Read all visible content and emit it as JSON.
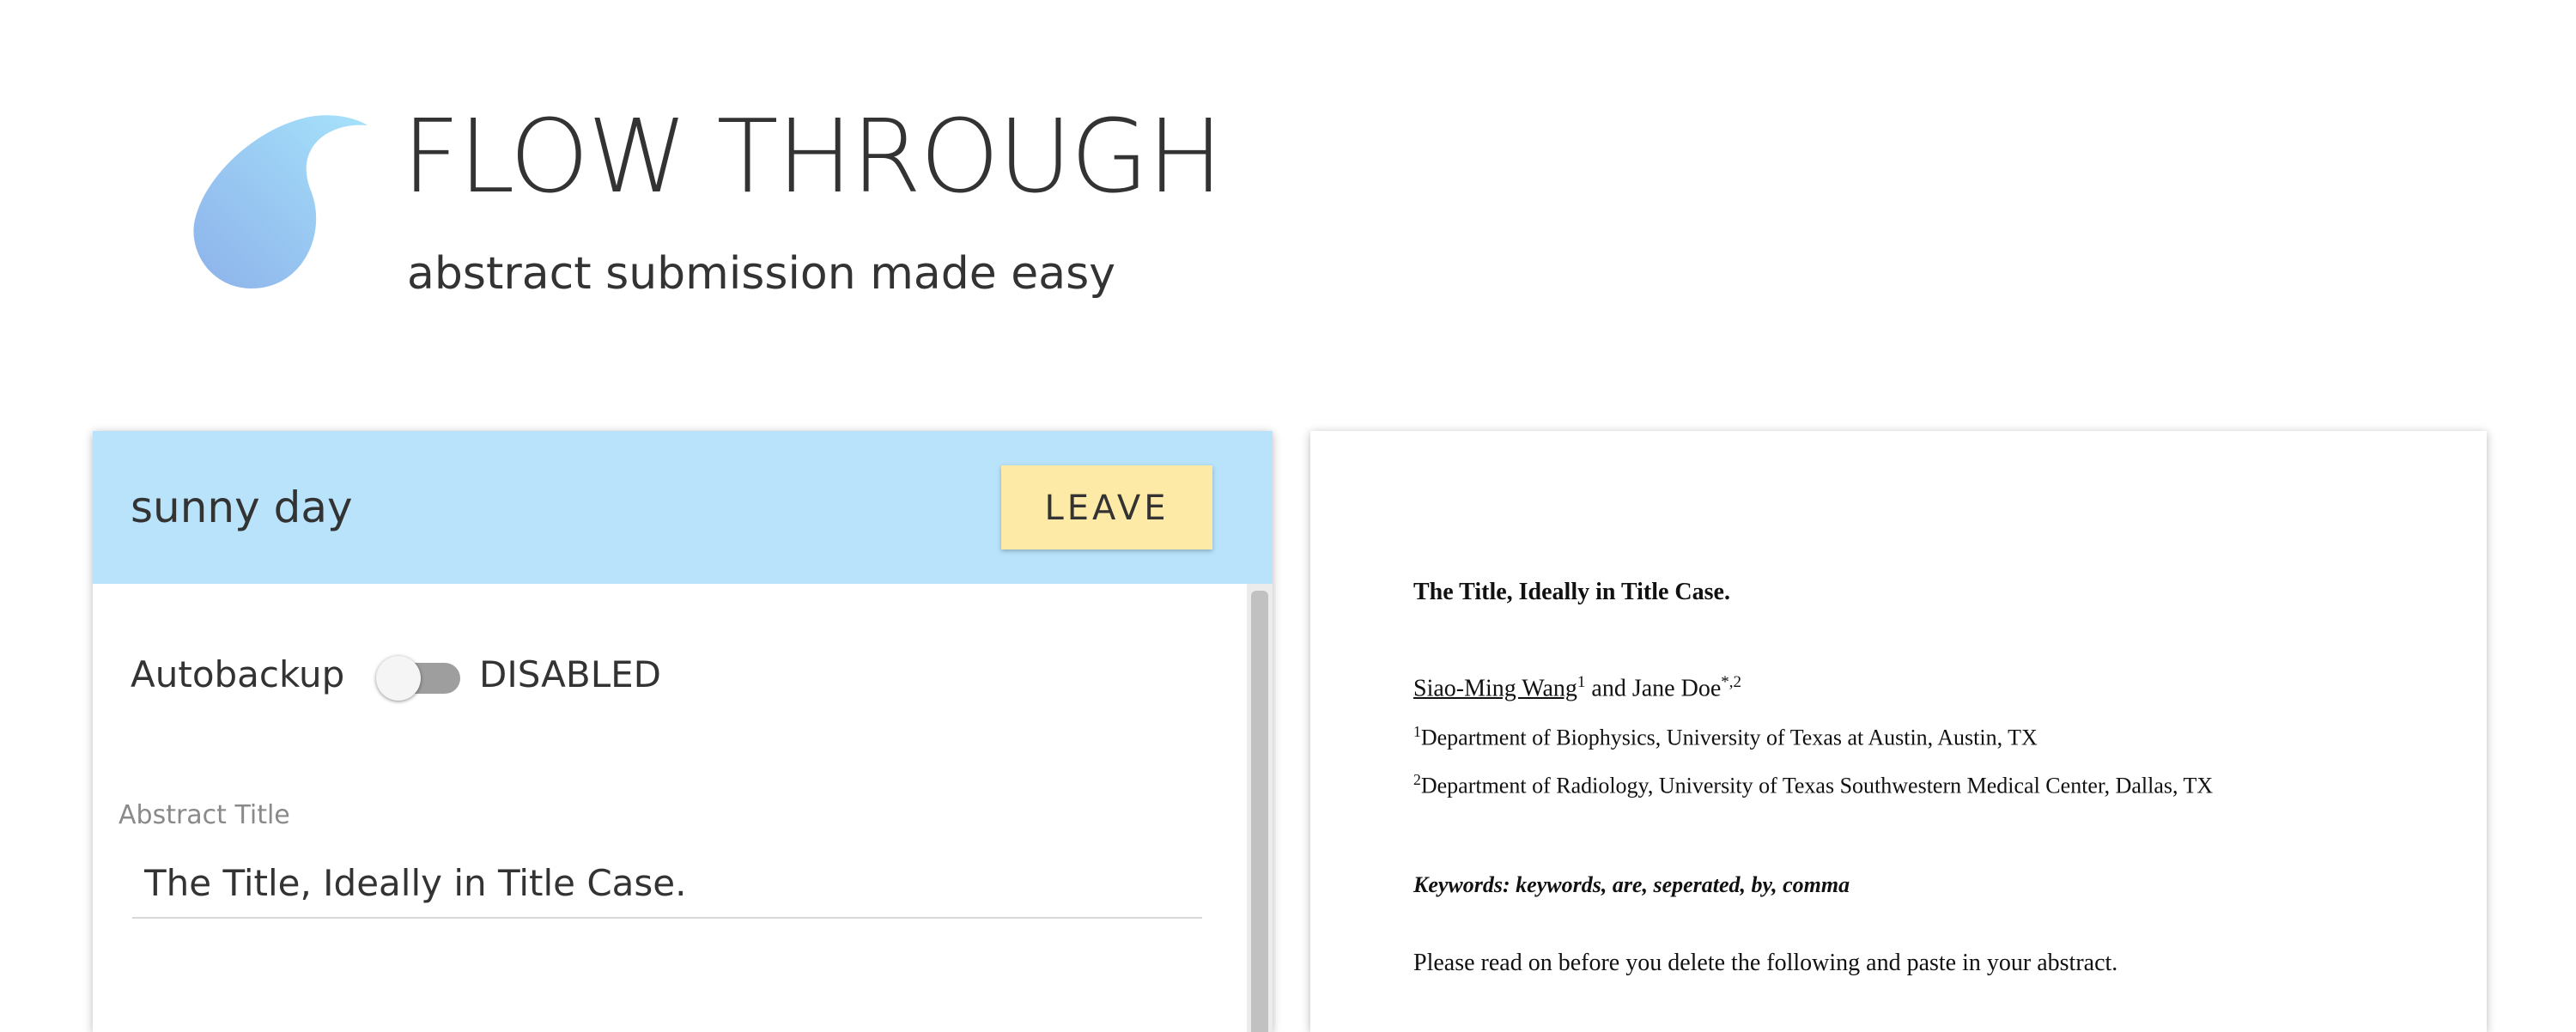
{
  "app": {
    "title": "FLOW THROUGH",
    "tagline": "abstract submission made easy",
    "brand_color": "#8fcff5"
  },
  "editor": {
    "session_name": "sunny day",
    "leave_label": "LEAVE",
    "autobackup_label": "Autobackup",
    "autobackup_enabled": false,
    "autobackup_status": "DISABLED",
    "title_field_label": "Abstract Title",
    "title_value": "The Title, Ideally in Title Case.",
    "header_color": "#b8e3fb",
    "leave_button_color": "#fdeaa7"
  },
  "preview": {
    "title": "The Title, Ideally in Title Case.",
    "author1_name": "Siao-Ming Wang",
    "author1_sup": "1",
    "author_joiner": " and ",
    "author2_name": "Jane Doe",
    "author2_sup": "*,2",
    "affil1_sup": "1",
    "affil1_text": "Department of Biophysics, University of Texas at Austin, Austin, TX",
    "affil2_sup": "2",
    "affil2_text": "Department of Radiology, University of Texas Southwestern Medical Center, Dallas, TX",
    "keywords": "Keywords: keywords, are, seperated, by, comma",
    "body_first_line": "Please read on before you delete the following and paste in your abstract."
  }
}
